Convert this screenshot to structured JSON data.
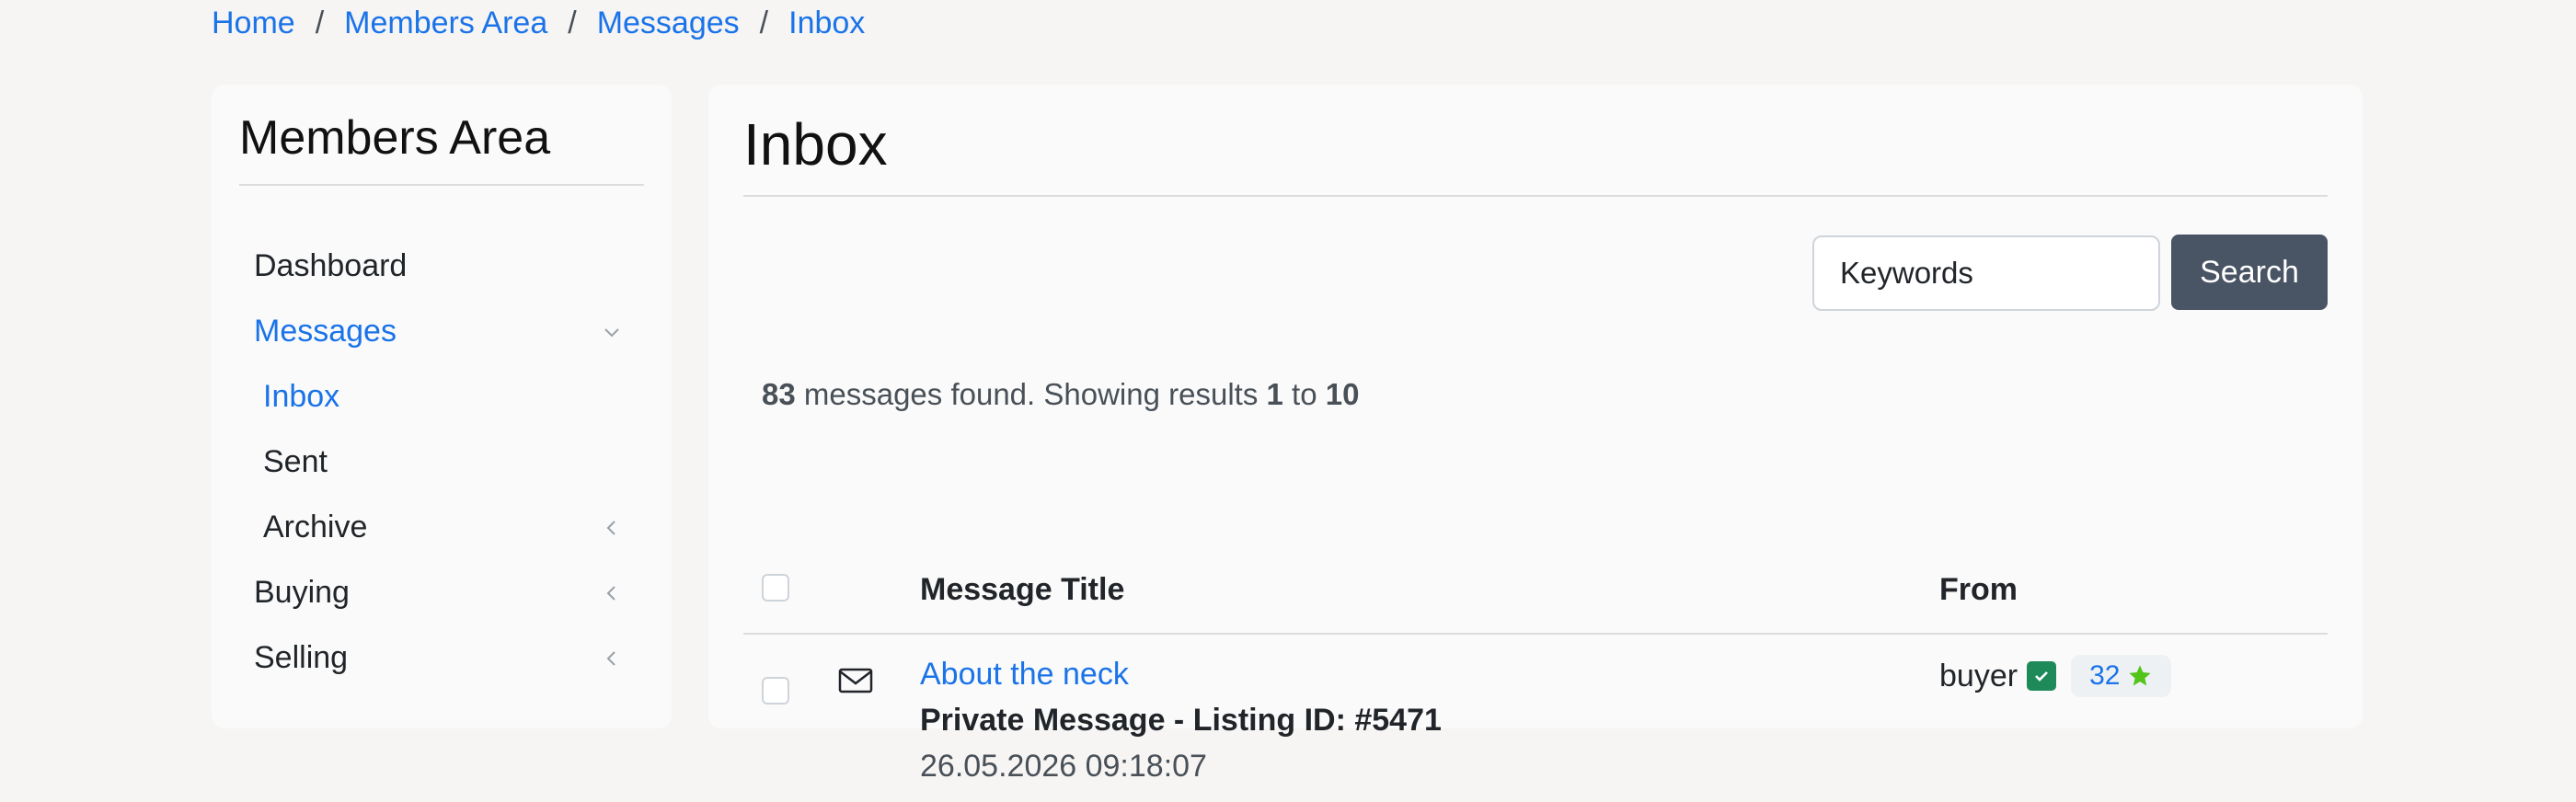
{
  "breadcrumb": {
    "items": [
      "Home",
      "Members Area",
      "Messages",
      "Inbox"
    ],
    "separator": "/"
  },
  "sidebar": {
    "title": "Members Area",
    "items": [
      {
        "label": "Dashboard",
        "state": "normal"
      },
      {
        "label": "Messages",
        "state": "active-expanded",
        "icon": "chevron-down-icon"
      },
      {
        "label": "Inbox",
        "state": "active-sub"
      },
      {
        "label": "Sent",
        "state": "sub"
      },
      {
        "label": "Archive",
        "state": "sub-collapsed",
        "icon": "chevron-left-icon"
      },
      {
        "label": "Buying",
        "state": "collapsed",
        "icon": "chevron-left-icon"
      },
      {
        "label": "Selling",
        "state": "collapsed",
        "icon": "chevron-left-icon"
      }
    ]
  },
  "main": {
    "title": "Inbox",
    "search": {
      "placeholder": "Keywords",
      "button": "Search"
    },
    "summary": {
      "count": "83",
      "text1": " messages found. Showing results ",
      "from": "1",
      "text2": " to ",
      "to": "10"
    },
    "table": {
      "columns": [
        "Message Title",
        "From"
      ],
      "rows": [
        {
          "title": "About the neck",
          "subtitle": "Private Message - Listing ID: #5471",
          "date": "26.05.2026 09:18:07",
          "from": "buyer",
          "rating": "32",
          "icon": "envelope-icon"
        }
      ]
    }
  },
  "colors": {
    "link": "#1a73e8",
    "button": "#495464",
    "verified": "#1e8a5a",
    "star": "#52c41a"
  }
}
